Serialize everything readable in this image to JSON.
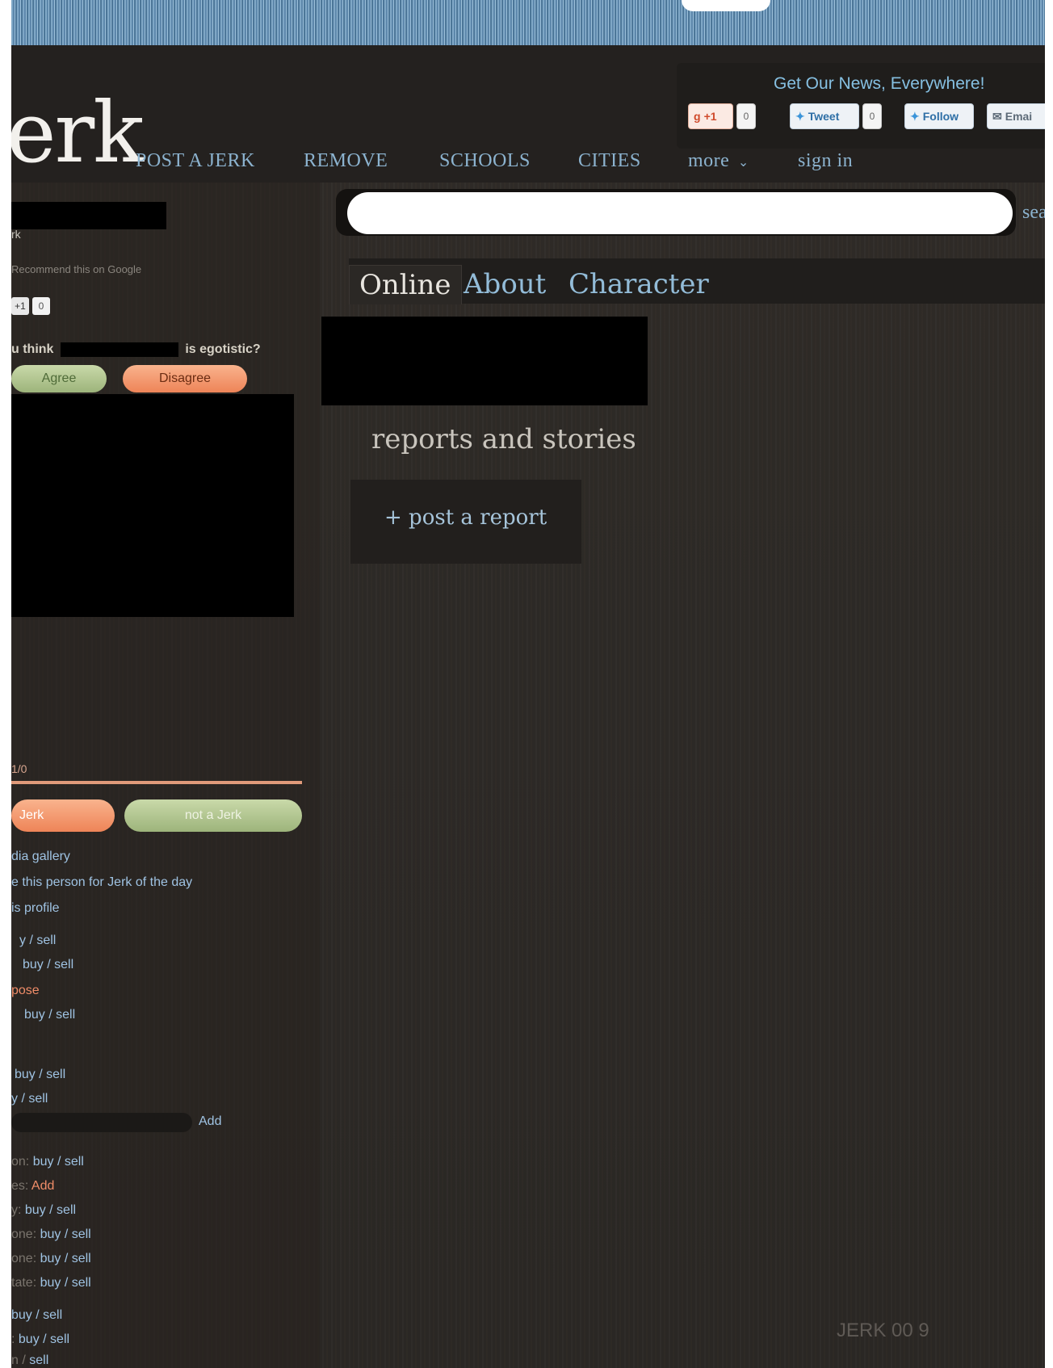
{
  "header": {
    "logo_text": "erk",
    "nav": [
      "POST A JERK",
      "REMOVE",
      "SCHOOLS",
      "CITIES",
      "more",
      "sign in"
    ],
    "more_caret": "⌄"
  },
  "social": {
    "title": "Get Our News, Everywhere!",
    "gplus_label": "+1",
    "gplus_count": "0",
    "tweet_label": "Tweet",
    "tweet_count": "0",
    "follow_label": "Follow",
    "email_label": "Emai"
  },
  "search": {
    "value": "",
    "label": "sear"
  },
  "tabs": [
    "Online",
    "About",
    "Character"
  ],
  "main": {
    "section_title": "reports and stories",
    "post_report": "+ post a report"
  },
  "sidebar": {
    "top_fragment": "rk",
    "recommend": "Recommend this on Google",
    "mini_count_a": "+1",
    "mini_count_b": "0",
    "vote_prefix": "u think",
    "vote_suffix": "is egotistic?",
    "agree": "Agree",
    "disagree": "Disagree",
    "score": "1/0",
    "jerk": "Jerk",
    "not_jerk": "not a Jerk",
    "links": [
      "dia gallery",
      "e this person for Jerk of the day",
      "is profile"
    ],
    "market": [
      {
        "prefix": "",
        "link": "y / sell",
        "color": "blue"
      },
      {
        "prefix": "",
        "link": "buy / sell",
        "color": "blue"
      },
      {
        "prefix": "",
        "link": "pose",
        "color": "orange"
      },
      {
        "prefix": "",
        "link": "buy / sell",
        "color": "blue"
      },
      {
        "prefix": "",
        "link": "buy / sell",
        "color": "blue"
      },
      {
        "prefix": "",
        "link": "y / sell",
        "color": "blue"
      }
    ],
    "add_label": "Add",
    "market2": [
      {
        "prefix": "on:",
        "link": "buy / sell",
        "color": "blue"
      },
      {
        "prefix": "es:",
        "link": "Add",
        "color": "orange"
      },
      {
        "prefix": "y:",
        "link": "buy / sell",
        "color": "blue"
      },
      {
        "prefix": "one:",
        "link": "buy / sell",
        "color": "blue"
      },
      {
        "prefix": "one:",
        "link": "buy / sell",
        "color": "blue"
      },
      {
        "prefix": "tate:",
        "link": "buy / sell",
        "color": "blue"
      },
      {
        "prefix": "",
        "link": "buy / sell",
        "color": "blue"
      },
      {
        "prefix": ":",
        "link": "buy / sell",
        "color": "blue"
      },
      {
        "prefix": "n /",
        "link": "sell",
        "color": "blue"
      }
    ]
  },
  "watermark": "JERK 00  9",
  "colors": {
    "accent_blue": "#8cb3cf",
    "orange": "#ee8458",
    "green": "#9db47b"
  }
}
